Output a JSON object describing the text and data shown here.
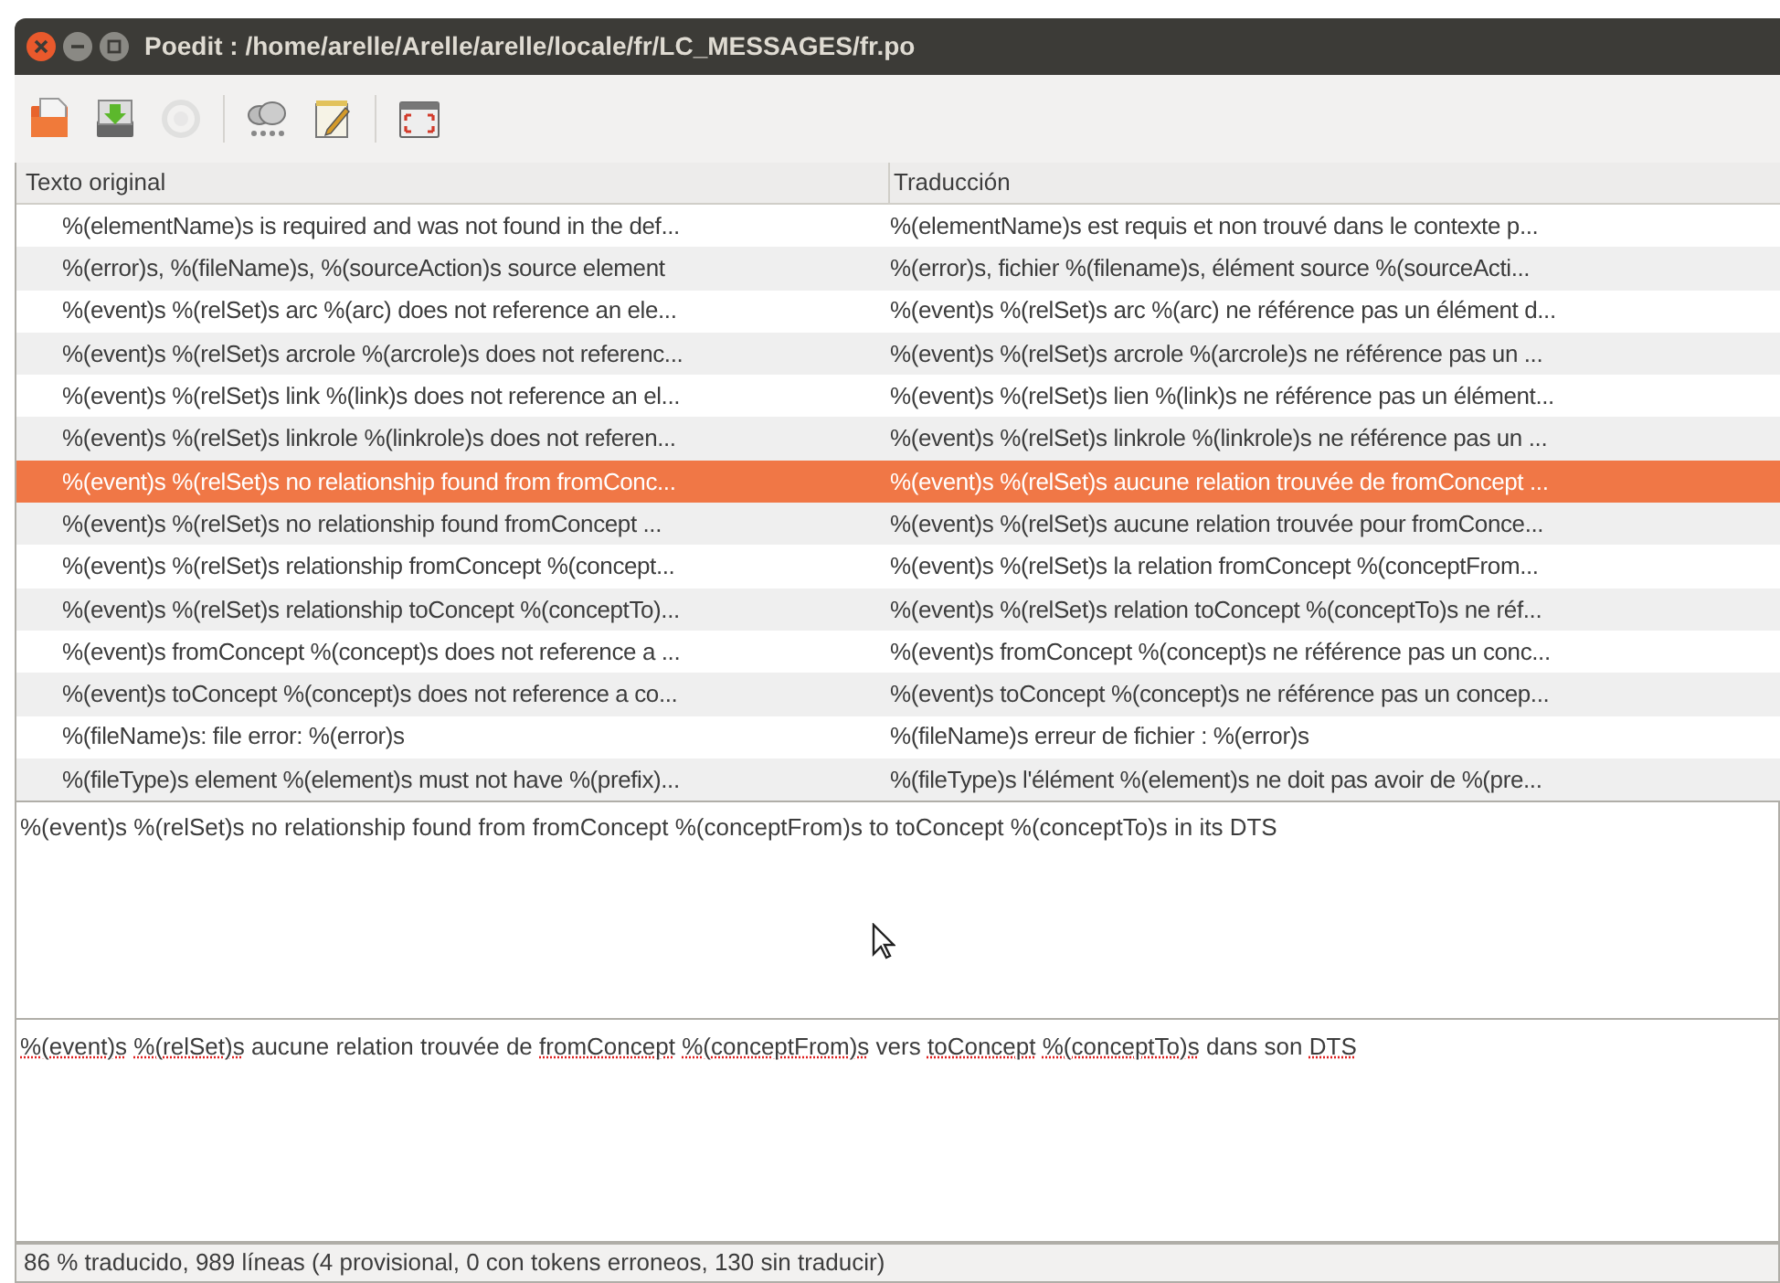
{
  "window": {
    "title": "Poedit : /home/arelle/Arelle/arelle/locale/fr/LC_MESSAGES/fr.po"
  },
  "toolbar": {
    "buttons": [
      {
        "kind": "open",
        "disabled": false
      },
      {
        "kind": "save",
        "disabled": false
      },
      {
        "kind": "update",
        "disabled": true
      },
      {
        "kind": "separator"
      },
      {
        "kind": "cloud",
        "disabled": false
      },
      {
        "kind": "edit",
        "disabled": false
      },
      {
        "kind": "separator"
      },
      {
        "kind": "fullscreen",
        "disabled": false
      }
    ]
  },
  "table": {
    "columns": [
      "Texto original",
      "Traducción"
    ],
    "rows": [
      {
        "source": "%(elementName)s is required and was not found in the def...",
        "translation": "%(elementName)s est requis et non trouvé dans le contexte p...",
        "selected": false
      },
      {
        "source": "%(error)s, %(fileName)s, %(sourceAction)s source element",
        "translation": "%(error)s, fichier %(filename)s, élément source %(sourceActi...",
        "selected": false
      },
      {
        "source": "%(event)s %(relSet)s arc %(arc) does not reference an ele...",
        "translation": "%(event)s %(relSet)s arc %(arc) ne référence pas un élément d...",
        "selected": false
      },
      {
        "source": "%(event)s %(relSet)s arcrole %(arcrole)s does not referenc...",
        "translation": "%(event)s %(relSet)s arcrole %(arcrole)s  ne référence pas un ...",
        "selected": false
      },
      {
        "source": "%(event)s %(relSet)s link %(link)s does not reference an el...",
        "translation": "%(event)s %(relSet)s lien %(link)s ne référence pas un élément...",
        "selected": false
      },
      {
        "source": "%(event)s %(relSet)s linkrole %(linkrole)s does not referen...",
        "translation": "%(event)s %(relSet)s linkrole %(linkrole)s ne référence pas un ...",
        "selected": false
      },
      {
        "source": "%(event)s %(relSet)s no relationship found from fromConc...",
        "translation": "%(event)s %(relSet)s aucune relation trouvée de fromConcept ...",
        "selected": true
      },
      {
        "source": "%(event)s %(relSet)s no relationship found fromConcept ...",
        "translation": "%(event)s %(relSet)s aucune relation trouvée pour fromConce...",
        "selected": false
      },
      {
        "source": "%(event)s %(relSet)s relationship fromConcept %(concept...",
        "translation": "%(event)s %(relSet)s la relation fromConcept %(conceptFrom...",
        "selected": false
      },
      {
        "source": "%(event)s %(relSet)s relationship toConcept %(conceptTo)...",
        "translation": "%(event)s %(relSet)s relation toConcept %(conceptTo)s ne réf...",
        "selected": false
      },
      {
        "source": "%(event)s fromConcept %(concept)s does not reference a ...",
        "translation": "%(event)s fromConcept %(concept)s ne référence pas un conc...",
        "selected": false
      },
      {
        "source": "%(event)s toConcept %(concept)s does not reference a co...",
        "translation": "%(event)s toConcept %(concept)s ne référence pas un concep...",
        "selected": false
      },
      {
        "source": "%(fileName)s: file error: %(error)s",
        "translation": "%(fileName)s erreur de fichier : %(error)s",
        "selected": false
      },
      {
        "source": "%(fileType)s element %(element)s must not have %(prefix)...",
        "translation": "%(fileType)s l'élément %(element)s ne doit pas avoir de %(pre...",
        "selected": false
      }
    ]
  },
  "source_pane": {
    "text": "%(event)s %(relSet)s no relationship found from fromConcept %(conceptFrom)s to toConcept %(conceptTo)s in its DTS"
  },
  "translation_pane": {
    "segments": [
      {
        "text": "%(event)s",
        "misspelled": true
      },
      {
        "text": "%(relSet)s",
        "misspelled": true
      },
      {
        "text": "aucune relation trouvée de",
        "misspelled": false
      },
      {
        "text": "fromConcept",
        "misspelled": true
      },
      {
        "text": "%(conceptFrom)s",
        "misspelled": true
      },
      {
        "text": "vers",
        "misspelled": false
      },
      {
        "text": "toConcept",
        "misspelled": true
      },
      {
        "text": "%(conceptTo)s",
        "misspelled": true
      },
      {
        "text": "dans son",
        "misspelled": false
      },
      {
        "text": "DTS",
        "misspelled": true
      }
    ]
  },
  "status_bar": "86 % traducido, 989 líneas (4 provisional, 0 con tokens erroneos, 130 sin traducir)"
}
